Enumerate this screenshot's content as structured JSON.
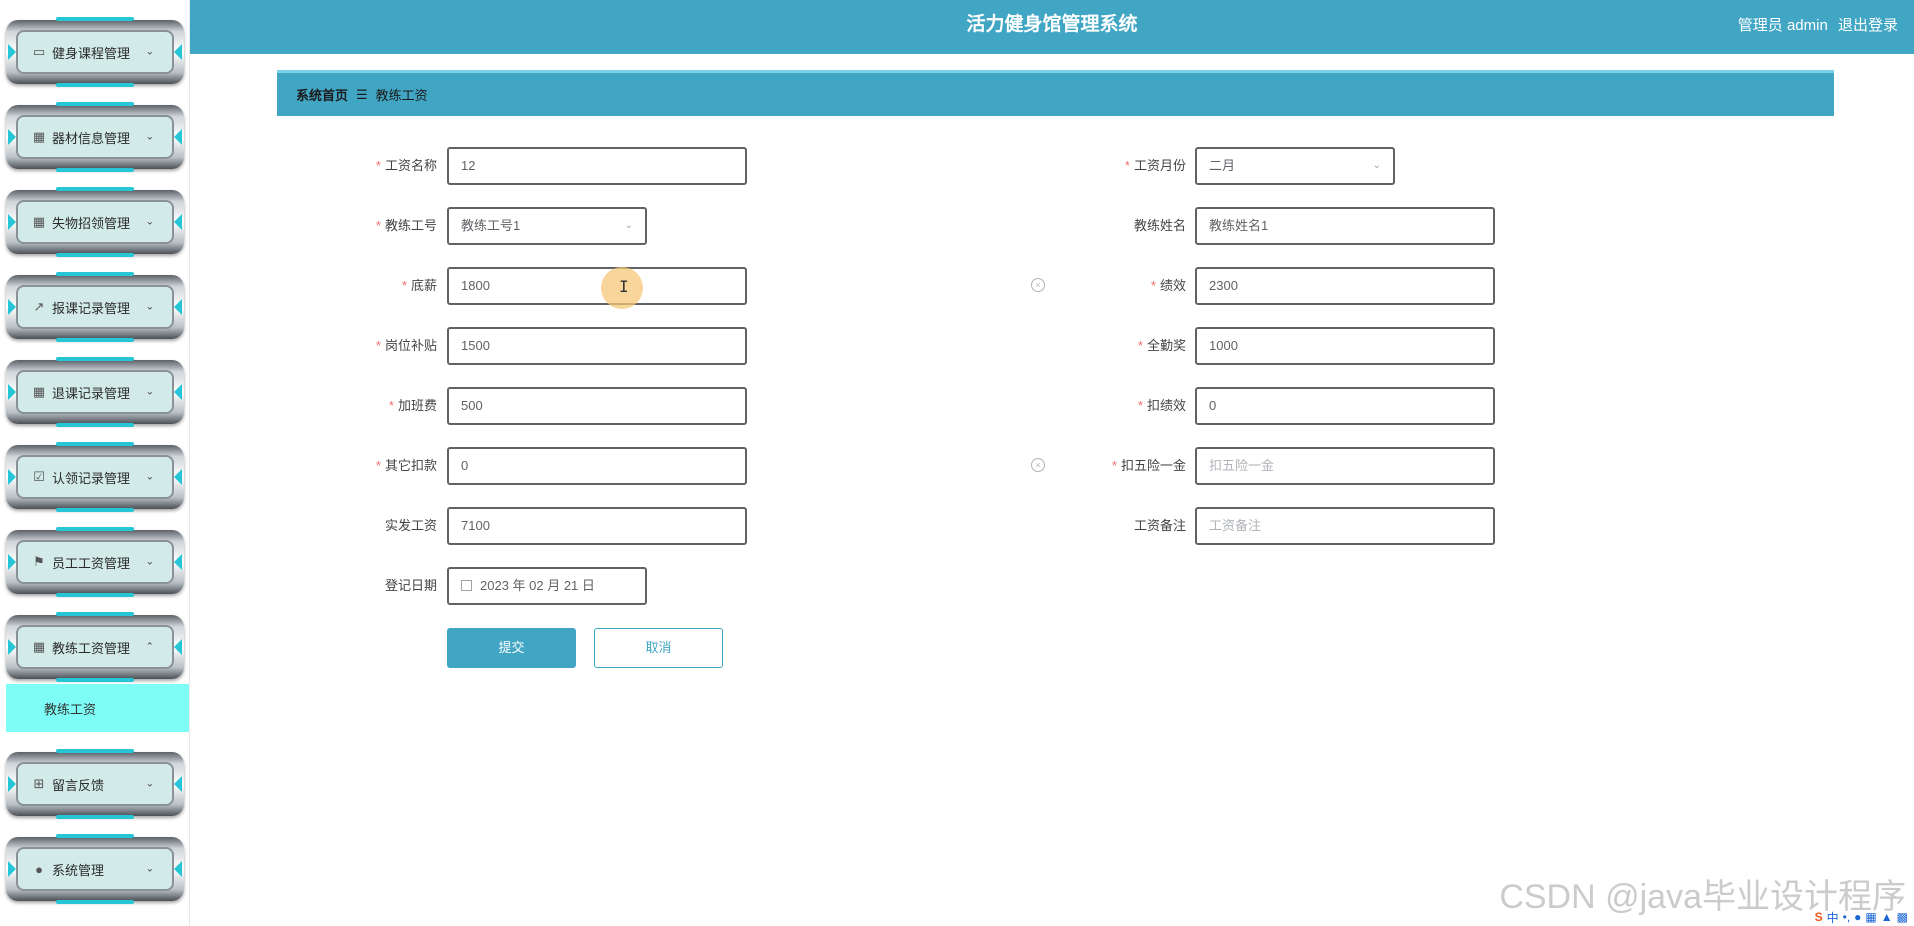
{
  "sidebar": {
    "items": [
      {
        "label": "健身课程管理",
        "icon": "monitor-icon",
        "expanded": false
      },
      {
        "label": "器材信息管理",
        "icon": "grid-icon",
        "expanded": false
      },
      {
        "label": "失物招领管理",
        "icon": "grid-icon",
        "expanded": false
      },
      {
        "label": "报课记录管理",
        "icon": "trend-icon",
        "expanded": false
      },
      {
        "label": "退课记录管理",
        "icon": "grid-icon",
        "expanded": false
      },
      {
        "label": "认领记录管理",
        "icon": "clipboard-check-icon",
        "expanded": false
      },
      {
        "label": "员工工资管理",
        "icon": "flag-icon",
        "expanded": false
      },
      {
        "label": "教练工资管理",
        "icon": "grid-icon",
        "expanded": true
      },
      {
        "label": "留言反馈",
        "icon": "apps-icon",
        "expanded": false
      },
      {
        "label": "系统管理",
        "icon": "bulb-icon",
        "expanded": false
      }
    ],
    "submenu": {
      "label": "教练工资"
    },
    "accent_color": "#26c6d6",
    "active_submenu_color": "#7efcf6"
  },
  "header": {
    "title": "活力健身馆管理系统",
    "user": "管理员 admin",
    "logout": "退出登录",
    "color": "#41a6c4"
  },
  "breadcrumb": {
    "home": "系统首页",
    "separator": "☰",
    "current": "教练工资"
  },
  "form": {
    "salary_name": {
      "label": "工资名称",
      "value": "12",
      "required": true
    },
    "salary_month": {
      "label": "工资月份",
      "value": "二月",
      "required": true
    },
    "coach_no": {
      "label": "教练工号",
      "value": "教练工号1",
      "required": true
    },
    "coach_name": {
      "label": "教练姓名",
      "value": "教练姓名1",
      "required": false
    },
    "base_pay": {
      "label": "底薪",
      "value": "1800",
      "required": true
    },
    "performance": {
      "label": "绩效",
      "value": "2300",
      "required": true
    },
    "post_allowance": {
      "label": "岗位补贴",
      "value": "1500",
      "required": true
    },
    "attendance_bonus": {
      "label": "全勤奖",
      "value": "1000",
      "required": true
    },
    "overtime_pay": {
      "label": "加班费",
      "value": "500",
      "required": true
    },
    "performance_deduction": {
      "label": "扣绩效",
      "value": "0",
      "required": true
    },
    "other_deduction": {
      "label": "其它扣款",
      "value": "0",
      "required": true
    },
    "insurance_deduction": {
      "label": "扣五险一金",
      "placeholder": "扣五险一金",
      "required": true
    },
    "net_pay": {
      "label": "实发工资",
      "value": "7100",
      "required": false
    },
    "salary_remark": {
      "label": "工资备注",
      "placeholder": "工资备注",
      "required": false
    },
    "register_date": {
      "label": "登记日期",
      "value": "2023 年 02 月 21 日",
      "required": false
    },
    "submit_label": "提交",
    "cancel_label": "取消",
    "required_mark": "*"
  },
  "watermark": "CSDN @java毕业设计程序",
  "ime": {
    "label": "中"
  }
}
